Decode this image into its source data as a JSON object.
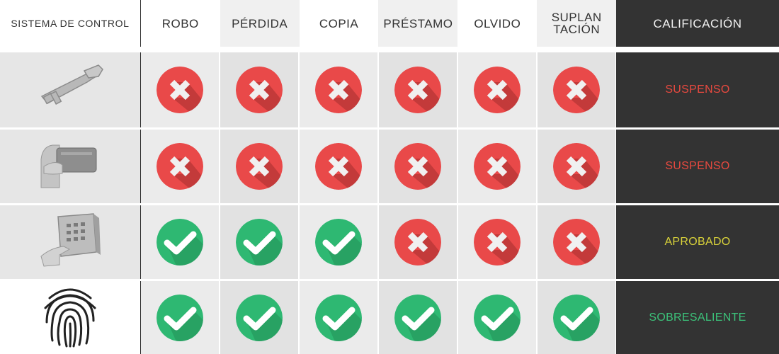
{
  "header": {
    "system": "SISTEMA DE CONTROL",
    "columns": [
      "ROBO",
      "PÉRDIDA",
      "COPIA",
      "PRÉSTAMO",
      "OLVIDO",
      "SUPLAN\nTACIÓN"
    ],
    "grade": "CALIFICACIÓN"
  },
  "colors": {
    "fail_badge": "#e94949",
    "pass_badge": "#2eb872",
    "fail_text": "#e8493f",
    "approved_text": "#d9d23a",
    "excellent_text": "#3cc27a",
    "grade_bg": "#333333"
  },
  "rows": [
    {
      "icon": "key-icon",
      "results": [
        "fail",
        "fail",
        "fail",
        "fail",
        "fail",
        "fail"
      ],
      "grade": "SUSPENSO",
      "grade_color": "#e8493f"
    },
    {
      "icon": "card-icon",
      "results": [
        "fail",
        "fail",
        "fail",
        "fail",
        "fail",
        "fail"
      ],
      "grade": "SUSPENSO",
      "grade_color": "#e8493f"
    },
    {
      "icon": "keypad-icon",
      "results": [
        "pass",
        "pass",
        "pass",
        "fail",
        "fail",
        "fail"
      ],
      "grade": "APROBADO",
      "grade_color": "#d9d23a"
    },
    {
      "icon": "fingerprint-icon",
      "results": [
        "pass",
        "pass",
        "pass",
        "pass",
        "pass",
        "pass"
      ],
      "grade": "SOBRESALIENTE",
      "grade_color": "#3cc27a"
    }
  ]
}
